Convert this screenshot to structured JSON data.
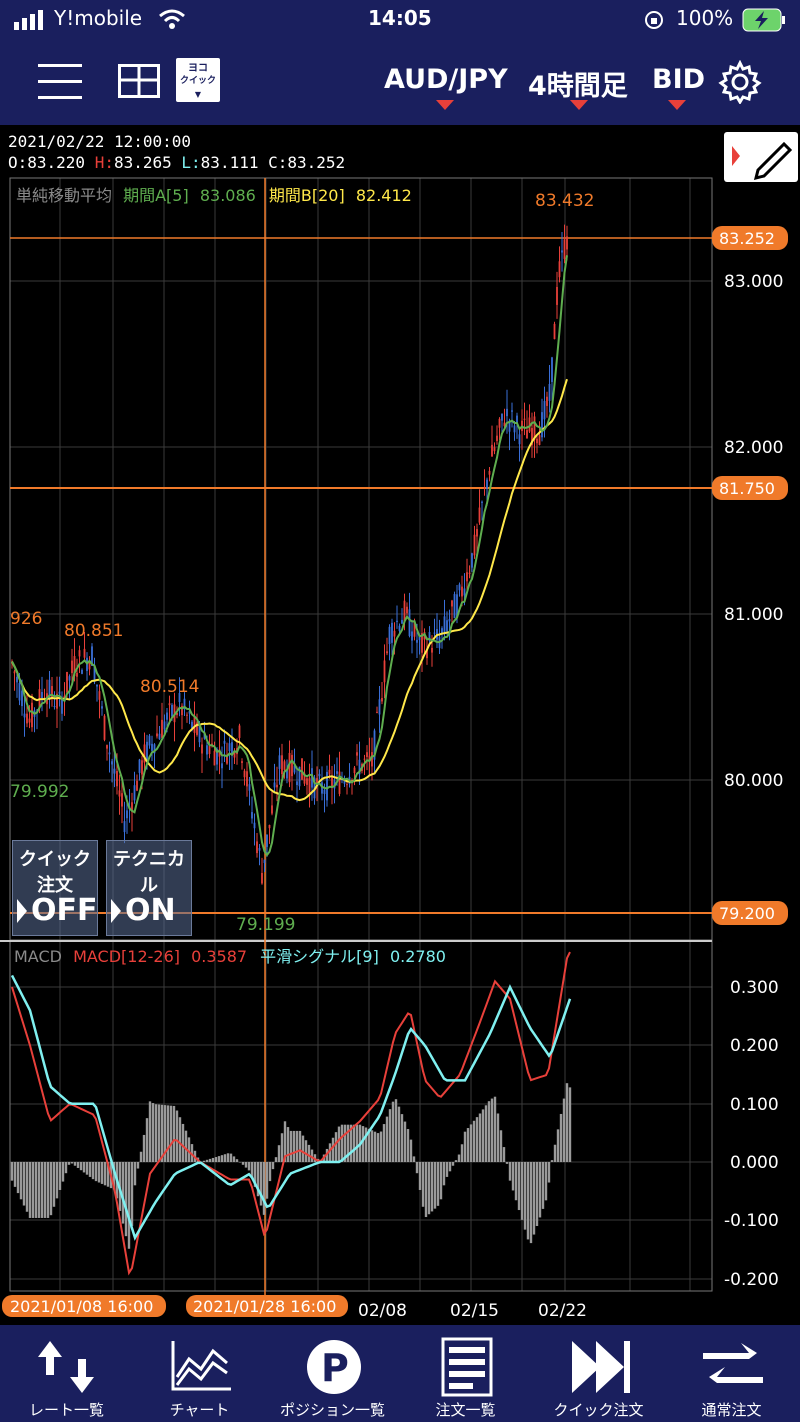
{
  "status": {
    "carrier": "Y!mobile",
    "time": "14:05",
    "battery": "100%"
  },
  "toolbar": {
    "yoko_top": "ヨコ",
    "yoko_bottom": "クイック",
    "pair": "AUD/JPY",
    "timeframe": "4時間足",
    "side": "BID"
  },
  "ohlc": {
    "datetime": "2021/02/22  12:00:00",
    "o_label": "O:",
    "o": "83.220",
    "h_label": "H:",
    "h": "83.265",
    "l_label": "L:",
    "l": "83.111",
    "c_label": "C:",
    "c": "83.252"
  },
  "sma": {
    "name": "単純移動平均",
    "a_label": "期間A[5]",
    "a_value": "83.086",
    "b_label": "期間B[20]",
    "b_value": "82.412"
  },
  "macd": {
    "name": "MACD",
    "macd_label": "MACD[12-26]",
    "macd_value": "0.3587",
    "signal_label": "平滑シグナル[9]",
    "signal_value": "0.2780"
  },
  "price_axis": [
    "83.000",
    "82.000",
    "81.000",
    "80.000"
  ],
  "macd_axis": [
    "0.300",
    "0.200",
    "0.100",
    "0.000",
    "-0.100",
    "-0.200"
  ],
  "price_markers": {
    "current": "83.252",
    "line1": "81.750",
    "line2": "79.200"
  },
  "annotations": {
    "high": "83.432",
    "a1": "926",
    "a2": "80.851",
    "a3": "80.514",
    "a4": "79.992",
    "low": "79.199"
  },
  "dates": [
    "02/08",
    "02/15",
    "02/22"
  ],
  "crosshair_dates": [
    "2021/01/08 16:00",
    "2021/01/28 16:00"
  ],
  "overlay": {
    "quick_title": "クイック注文",
    "quick_value": "OFF",
    "tech_title": "テクニカル",
    "tech_value": "ON"
  },
  "nav": [
    "レート一覧",
    "チャート",
    "ポジション一覧",
    "注文一覧",
    "クイック注文",
    "通常注文"
  ],
  "colors": {
    "bar": "#1a1f5e",
    "orange": "#f07a2a",
    "green": "#5fae4f",
    "yellow": "#ffe84a",
    "red": "#e8403a",
    "cyan": "#7ff0f0"
  }
}
